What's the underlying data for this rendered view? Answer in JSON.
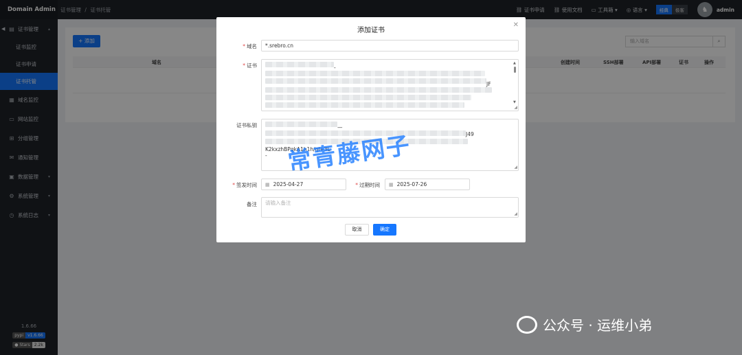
{
  "app": {
    "brand": "Domain Admin"
  },
  "breadcrumb": [
    "证书管理",
    "/",
    "证书托管"
  ],
  "sidebar": {
    "items": [
      {
        "icon": "▤",
        "label": "证书管理",
        "expanded": true
      },
      {
        "label": "证书监控"
      },
      {
        "label": "证书申请"
      },
      {
        "label": "证书托管",
        "active": true
      },
      {
        "icon": "▦",
        "label": "域名监控"
      },
      {
        "icon": "▭",
        "label": "网站监控"
      },
      {
        "icon": "⊞",
        "label": "分组管理"
      },
      {
        "icon": "✉",
        "label": "通知管理"
      },
      {
        "icon": "▣",
        "label": "数据管理"
      },
      {
        "icon": "⚙",
        "label": "系统管理"
      },
      {
        "icon": "◷",
        "label": "系统日志"
      }
    ],
    "version": "1.6.66",
    "badge_pypi": [
      "pypi",
      "v1.6.66"
    ],
    "badge_github": [
      "Stars",
      "2.2k"
    ]
  },
  "header": {
    "links": [
      {
        "icon": "🔗",
        "label": "证书申请"
      },
      {
        "icon": "🔗",
        "label": "使用文档"
      },
      {
        "icon": "▭",
        "label": "工具箱"
      },
      {
        "icon": "◎",
        "label": "语言"
      }
    ],
    "theme_options": [
      "经典",
      "极客"
    ],
    "user": "admin"
  },
  "main": {
    "add_button": "+ 添加",
    "search_placeholder": "输入域名",
    "columns": [
      "域名",
      "创建时间",
      "SSH部署",
      "API部署",
      "证书",
      "操作"
    ]
  },
  "modal": {
    "title": "添加证书",
    "fields": {
      "domain": {
        "label": "域名",
        "value": "*.srebro.cn"
      },
      "cert": {
        "label": "证书",
        "visible_fragments": [
          "-",
          "JF"
        ]
      },
      "key": {
        "label": "证书私钥",
        "visible_fragments": [
          "—",
          "J49",
          "K2kxzhBPqkA1h1h/ql+3L",
          "-"
        ]
      },
      "issue_time": {
        "label": "签发时间",
        "value": "2025-04-27"
      },
      "expire_time": {
        "label": "过期时间",
        "value": "2025-07-26"
      },
      "remark": {
        "label": "备注",
        "placeholder": "请输入备注"
      }
    },
    "cancel": "取消",
    "ok": "确定"
  },
  "watermark": {
    "text": "常青藤网子",
    "wechat": "公众号 · 运维小弟"
  }
}
